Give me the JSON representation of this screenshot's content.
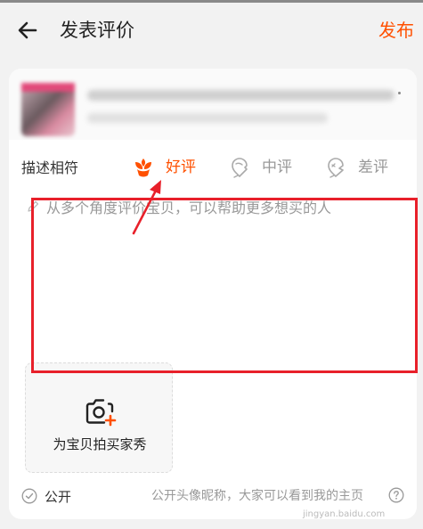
{
  "header": {
    "title": "发表评价",
    "publish_label": "发布"
  },
  "product": {
    "title_text": "",
    "subtitle_text": ""
  },
  "rating": {
    "label": "描述相符",
    "options": [
      {
        "label": "好评",
        "icon": "flower-icon",
        "selected": true
      },
      {
        "label": "中评",
        "icon": "mid-rating-icon",
        "selected": false
      },
      {
        "label": "差评",
        "icon": "bad-rating-icon",
        "selected": false
      }
    ]
  },
  "review": {
    "placeholder": "从多个角度评价宝贝，可以帮助更多想买的人"
  },
  "photo": {
    "label": "为宝贝拍买家秀"
  },
  "privacy": {
    "public_label": "公开",
    "hint": "公开头像昵称，大家可以看到我的主页"
  },
  "watermark": "jingyan.baidu.com",
  "colors": {
    "accent": "#ff5000",
    "annotation": "#e8202a",
    "background": "#f2f2f2"
  }
}
